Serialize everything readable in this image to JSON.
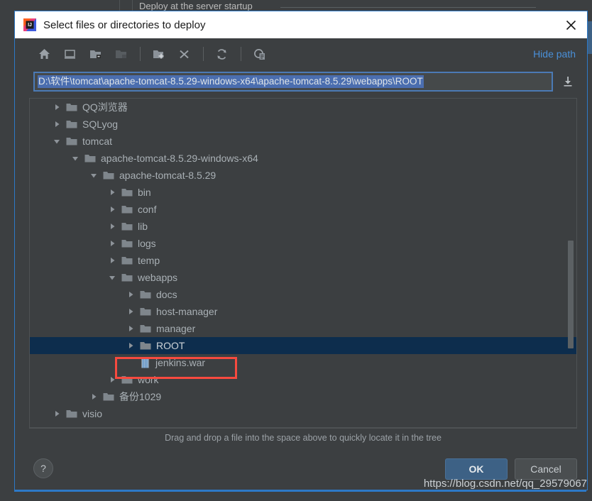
{
  "background": {
    "deploy_label": "Deploy at the server startup"
  },
  "dialog": {
    "title": "Select files or directories to deploy",
    "app_icon": "intellij-idea-icon",
    "close_icon": "close-icon",
    "toolbar": {
      "buttons": [
        {
          "name": "home-icon",
          "tooltip": "Home"
        },
        {
          "name": "desktop-icon",
          "tooltip": "Desktop"
        },
        {
          "name": "project-folder-icon",
          "tooltip": "Project Directory"
        },
        {
          "name": "module-folder-icon",
          "tooltip": "Module Directory"
        },
        {
          "name": "new-folder-icon",
          "tooltip": "New Folder"
        },
        {
          "name": "delete-icon",
          "tooltip": "Delete"
        },
        {
          "name": "refresh-icon",
          "tooltip": "Refresh"
        },
        {
          "name": "show-hidden-icon",
          "tooltip": "Show Hidden Files"
        }
      ],
      "hide_path_label": "Hide path"
    },
    "path_field": {
      "value": "D:\\软件\\tomcat\\apache-tomcat-8.5.29-windows-x64\\apache-tomcat-8.5.29\\webapps\\ROOT",
      "expand_icon": "expand-down-icon"
    },
    "tree": {
      "items": [
        {
          "label": "QQ浏览器",
          "indent": 1,
          "state": "collapsed",
          "icon": "folder-icon",
          "selected": false
        },
        {
          "label": "SQLyog",
          "indent": 1,
          "state": "collapsed",
          "icon": "folder-icon",
          "selected": false
        },
        {
          "label": "tomcat",
          "indent": 1,
          "state": "expanded",
          "icon": "folder-icon",
          "selected": false
        },
        {
          "label": "apache-tomcat-8.5.29-windows-x64",
          "indent": 2,
          "state": "expanded",
          "icon": "folder-icon",
          "selected": false
        },
        {
          "label": "apache-tomcat-8.5.29",
          "indent": 3,
          "state": "expanded",
          "icon": "folder-icon",
          "selected": false
        },
        {
          "label": "bin",
          "indent": 4,
          "state": "collapsed",
          "icon": "folder-icon",
          "selected": false
        },
        {
          "label": "conf",
          "indent": 4,
          "state": "collapsed",
          "icon": "folder-icon",
          "selected": false
        },
        {
          "label": "lib",
          "indent": 4,
          "state": "collapsed",
          "icon": "folder-icon",
          "selected": false
        },
        {
          "label": "logs",
          "indent": 4,
          "state": "collapsed",
          "icon": "folder-icon",
          "selected": false
        },
        {
          "label": "temp",
          "indent": 4,
          "state": "collapsed",
          "icon": "folder-icon",
          "selected": false
        },
        {
          "label": "webapps",
          "indent": 4,
          "state": "expanded",
          "icon": "folder-icon",
          "selected": false
        },
        {
          "label": "docs",
          "indent": 5,
          "state": "collapsed",
          "icon": "folder-icon",
          "selected": false
        },
        {
          "label": "host-manager",
          "indent": 5,
          "state": "collapsed",
          "icon": "folder-icon",
          "selected": false
        },
        {
          "label": "manager",
          "indent": 5,
          "state": "collapsed",
          "icon": "folder-icon",
          "selected": false
        },
        {
          "label": "ROOT",
          "indent": 5,
          "state": "collapsed",
          "icon": "folder-icon",
          "selected": true
        },
        {
          "label": "jenkins.war",
          "indent": 5,
          "state": "leaf",
          "icon": "war-archive-icon",
          "selected": false
        },
        {
          "label": "work",
          "indent": 4,
          "state": "collapsed",
          "icon": "folder-icon",
          "selected": false
        },
        {
          "label": "备份1029",
          "indent": 3,
          "state": "collapsed",
          "icon": "folder-icon",
          "selected": false
        },
        {
          "label": "visio",
          "indent": 1,
          "state": "collapsed",
          "icon": "folder-icon",
          "selected": false
        }
      ],
      "hint": "Drag and drop a file into the space above to quickly locate it in the tree"
    },
    "actions": {
      "help_label": "?",
      "ok_label": "OK",
      "cancel_label": "Cancel"
    }
  },
  "watermark": "https://blog.csdn.net/qq_29579067",
  "colors": {
    "dialog_border": "#2d79c7",
    "accent_link": "#4a90d9",
    "selection_row": "#0d2d4d",
    "path_selection": "#4b6eaf",
    "annotation": "#f74a3f",
    "ok_button": "#3d6185",
    "panel_bg": "#3c3f41"
  }
}
